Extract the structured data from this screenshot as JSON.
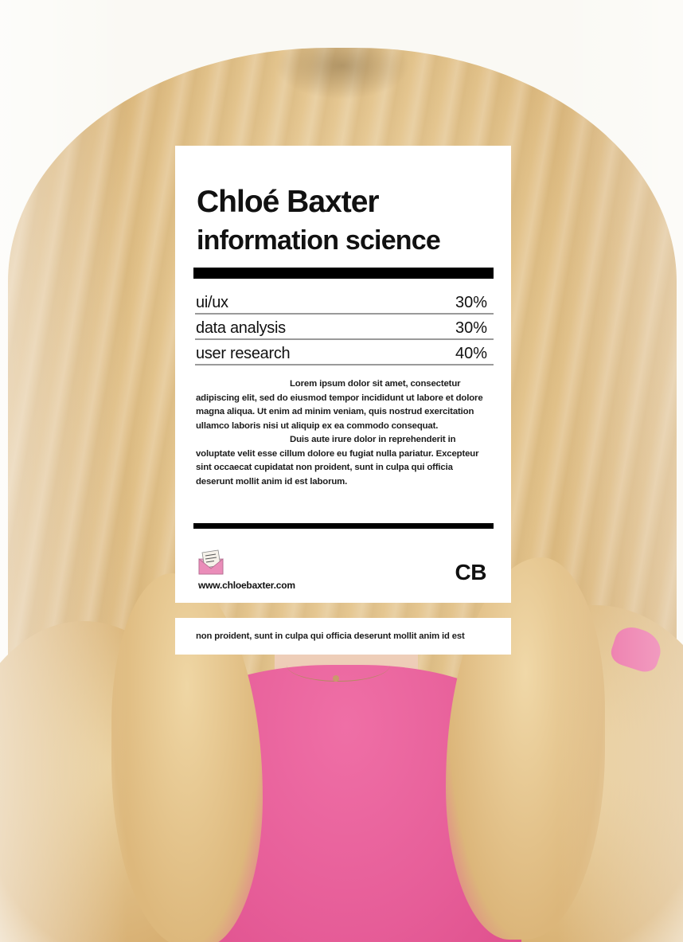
{
  "card": {
    "name": "Chloé Baxter",
    "field": "information science",
    "skills": [
      {
        "label": "ui/ux",
        "percent": "30%"
      },
      {
        "label": "data analysis",
        "percent": "30%"
      },
      {
        "label": "user research",
        "percent": "40%"
      }
    ],
    "description": [
      "Lorem ipsum dolor sit amet, consectetur adipiscing elit, sed do eiusmod tempor incididunt ut labore et dolore magna aliqua. Ut enim ad minim veniam, quis nostrud exercitation ullamco laboris nisi ut aliquip ex ea commodo consequat.",
      "Duis aute irure dolor in reprehenderit in voluptate velit esse cillum dolore eu fugiat nulla pariatur. Excepteur sint occaecat cupidatat non proident, sunt in culpa qui officia deserunt mollit anim id est laborum."
    ],
    "website": "www.chloebaxter.com",
    "monogram": "CB",
    "logo_icon": "envelope-logo-icon"
  },
  "footer": {
    "text": "non proident, sunt in culpa qui officia deserunt mollit anim id est"
  },
  "colors": {
    "card_background": "#ffffff",
    "rule": "#000000",
    "divider": "#9a9a9a",
    "hair": "#e3c186",
    "shirt": "#e65d98",
    "logo_pink": "#e7a1c4"
  }
}
